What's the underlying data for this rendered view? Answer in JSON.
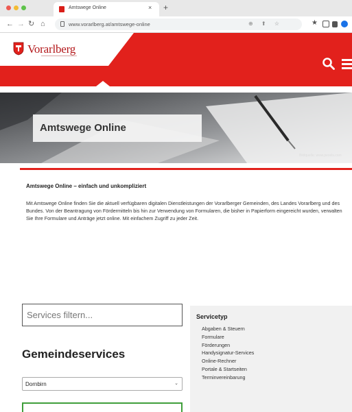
{
  "browser": {
    "tab_title": "Amtswege Online",
    "url": "www.vorarlberg.at/amtswege-online"
  },
  "colors": {
    "brand_red": "#e2211c",
    "filter_green": "#3f9e3a"
  },
  "icons": [
    "crest-icon",
    "search-icon",
    "menu-icon",
    "lock-icon",
    "star-icon"
  ],
  "header": {
    "logo": "Vorarlberg"
  },
  "hero": {
    "title": "Amtswege Online",
    "credit": "Bildquelle: www.pexels.com"
  },
  "intro": {
    "heading": "Amtswege Online – einfach und unkompliziert",
    "body": "Mit Amtswege Online finden Sie die aktuell verfügbaren digitalen Dienstleistungen der Vorarlberger Gemeinden, des Landes Vorarlberg und des Bundes. Von der Beantragung von Fördermitteln bis hin zur Verwendung von Formularen, die bisher in Papierform eingereicht wurden, verwalten Sie Ihre Formulare und Anträge jetzt online. Mit einfachem Zugriff zu jeder Zeit."
  },
  "filter": {
    "placeholder": "Services filtern..."
  },
  "gemeinde": {
    "heading": "Gemeindeservices",
    "selected": "Dornbirn"
  },
  "servicetyp": {
    "heading": "Servicetyp",
    "items": [
      "Abgaben & Steuern",
      "Formulare",
      "Förderungen",
      "Handysignatur-Services",
      "Online-Rechner",
      "Portale & Startseiten",
      "Terminvereinbarung"
    ]
  }
}
